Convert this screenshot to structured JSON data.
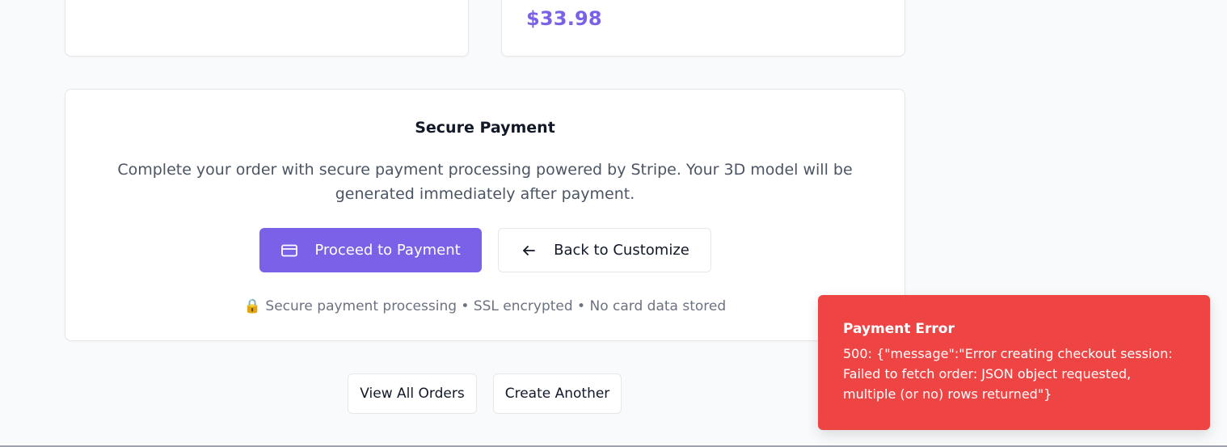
{
  "summary": {
    "total_price": "$33.98"
  },
  "payment": {
    "title": "Secure Payment",
    "description": "Complete your order with secure payment processing powered by Stripe. Your 3D model will be generated immediately after payment.",
    "proceed_label": "Proceed to Payment",
    "proceed_icon": "credit-card-icon",
    "back_label": "Back to Customize",
    "back_icon": "arrow-left-icon",
    "secure_note_icon": "🔒",
    "secure_note": "Secure payment processing • SSL encrypted • No card data stored"
  },
  "actions": {
    "view_orders_label": "View All Orders",
    "create_another_label": "Create Another"
  },
  "toast": {
    "title": "Payment Error",
    "message": "500: {\"message\":\"Error creating checkout session: Failed to fetch order: JSON object requested, multiple (or no) rows returned\"}"
  },
  "colors": {
    "accent": "#7b61e8",
    "error": "#ef4444",
    "background": "#f9fafb"
  }
}
